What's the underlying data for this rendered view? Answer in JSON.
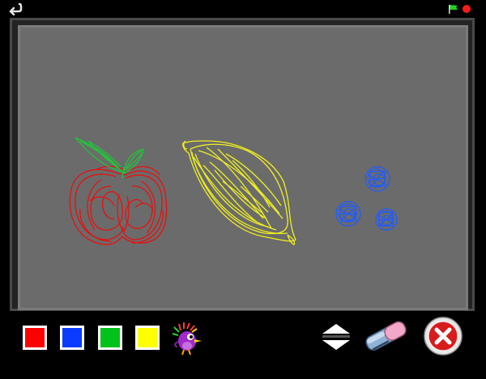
{
  "colors": {
    "background": "#000000",
    "canvas": "#6b6b6b",
    "canvas_border": "#7a7a7a",
    "frame": "#232323",
    "red": "#ff0000",
    "blue": "#0a3cff",
    "green": "#00c21a",
    "yellow": "#ffff00",
    "close_red": "#d81b1b"
  },
  "palette": [
    {
      "name": "red",
      "color": "#ff0000"
    },
    {
      "name": "blue",
      "color": "#0a3cff"
    },
    {
      "name": "green",
      "color": "#00c21a"
    },
    {
      "name": "yellow",
      "color": "#ffff00"
    }
  ],
  "icons": {
    "back": "back-arrow-icon",
    "flag": "green-flag-icon",
    "record": "red-dot-icon",
    "mascot": "purple-bird-mascot-icon",
    "size": "up-down-arrows-icon",
    "eraser": "eraser-icon",
    "close": "close-x-icon"
  },
  "drawing": {
    "strokes": [
      "apple-red",
      "apple-leaves-green",
      "lemon-yellow",
      "berries-blue"
    ]
  }
}
